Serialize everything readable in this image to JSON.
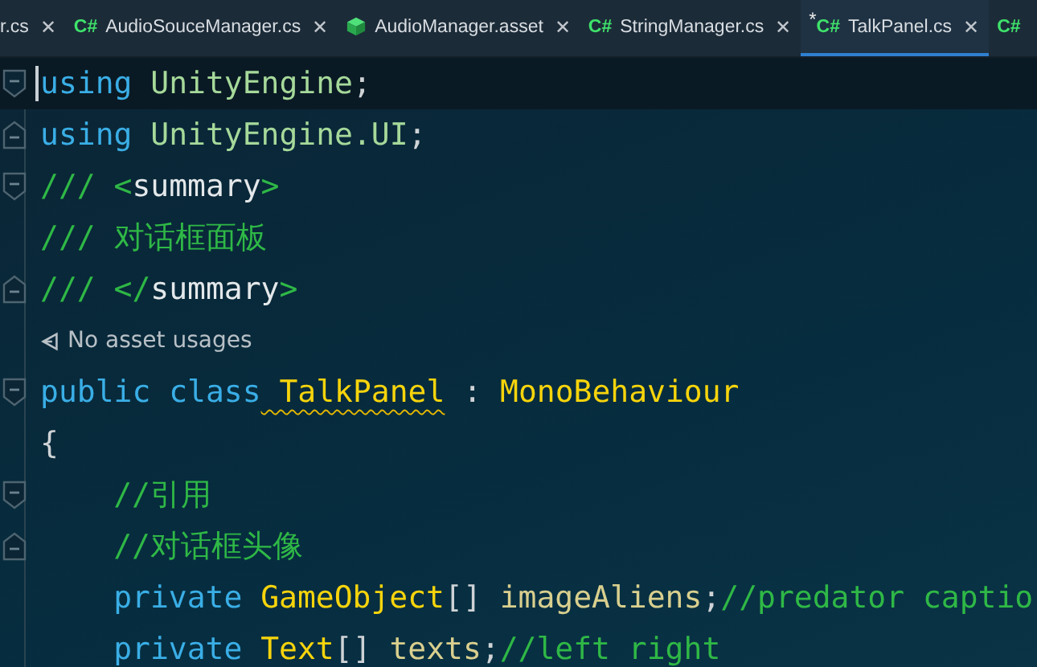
{
  "tabs": [
    {
      "kind": "cs",
      "label": "r.cs",
      "selected": false,
      "close": "✕"
    },
    {
      "kind": "cs",
      "icon": "C#",
      "label": "AudioSouceManager.cs",
      "selected": false,
      "close": "✕"
    },
    {
      "kind": "asset",
      "label": "AudioManager.asset",
      "selected": false,
      "close": "✕"
    },
    {
      "kind": "cs",
      "icon": "C#",
      "label": "StringManager.cs",
      "selected": false,
      "close": "✕"
    },
    {
      "kind": "cs",
      "modified_marker": "*",
      "icon": "C#",
      "label": "TalkPanel.cs",
      "selected": true,
      "close": "✕"
    },
    {
      "kind": "cs",
      "icon": "C#",
      "selected": false
    }
  ],
  "editor": {
    "lines": [
      {
        "kind": "code",
        "fold_start": true,
        "fold_end": false,
        "current": true,
        "tokens": [
          {
            "kind": "keyword",
            "text": "using"
          },
          {
            "kind": "namespace",
            "text": " UnityEngine"
          },
          {
            "kind": "punct",
            "text": ";"
          }
        ]
      },
      {
        "kind": "code",
        "fold_start": false,
        "fold_end": true,
        "current": false,
        "tokens": [
          {
            "kind": "keyword",
            "text": "using"
          },
          {
            "kind": "namespace",
            "text": " UnityEngine.UI"
          },
          {
            "kind": "punct",
            "text": ";"
          }
        ]
      },
      {
        "kind": "code",
        "fold_start": true,
        "fold_end": false,
        "current": false,
        "tokens": [
          {
            "kind": "comment",
            "text": "/// <"
          },
          {
            "kind": "doc",
            "text": "summary"
          },
          {
            "kind": "comment",
            "text": ">"
          }
        ]
      },
      {
        "kind": "code",
        "fold_start": false,
        "fold_end": false,
        "current": false,
        "tokens": [
          {
            "kind": "comment",
            "text": "/// 对话框面板"
          }
        ]
      },
      {
        "kind": "code",
        "fold_start": false,
        "fold_end": true,
        "current": false,
        "tokens": [
          {
            "kind": "comment",
            "text": "/// </"
          },
          {
            "kind": "doc",
            "text": "summary"
          },
          {
            "kind": "comment",
            "text": ">"
          }
        ]
      },
      {
        "kind": "hint",
        "text": "No asset usages"
      },
      {
        "kind": "code",
        "fold_start": true,
        "fold_end": false,
        "current": false,
        "tokens": [
          {
            "kind": "keyword",
            "text": "public class"
          },
          {
            "kind": "type",
            "text": " TalkPanel",
            "warning": true
          },
          {
            "kind": "punct",
            "text": " : "
          },
          {
            "kind": "type",
            "text": "MonoBehaviour"
          }
        ]
      },
      {
        "kind": "code",
        "fold_start": false,
        "fold_end": false,
        "current": false,
        "tokens": [
          {
            "kind": "punct",
            "text": "{"
          }
        ]
      },
      {
        "kind": "member",
        "fold_start": true,
        "fold_end": false,
        "current": false,
        "tokens": [
          {
            "kind": "comment",
            "text": "//引用"
          }
        ]
      },
      {
        "kind": "member",
        "fold_start": false,
        "fold_end": true,
        "current": false,
        "tokens": [
          {
            "kind": "comment",
            "text": "//对话框头像"
          }
        ]
      },
      {
        "kind": "member",
        "fold_start": false,
        "fold_end": false,
        "current": false,
        "tokens": [
          {
            "kind": "keyword",
            "text": "private"
          },
          {
            "kind": "type",
            "text": " GameObject"
          },
          {
            "kind": "punct",
            "text": "[]"
          },
          {
            "kind": "field",
            "text": " imageAliens"
          },
          {
            "kind": "punct",
            "text": ";"
          },
          {
            "kind": "comment",
            "text": "//predator captio"
          }
        ]
      },
      {
        "kind": "member",
        "fold_start": false,
        "fold_end": false,
        "current": false,
        "tokens": [
          {
            "kind": "keyword",
            "text": "private"
          },
          {
            "kind": "type",
            "text": " Text"
          },
          {
            "kind": "punct",
            "text": "[]"
          },
          {
            "kind": "field",
            "text": " texts"
          },
          {
            "kind": "punct",
            "text": ";"
          },
          {
            "kind": "comment",
            "text": "//left right"
          }
        ]
      }
    ]
  }
}
